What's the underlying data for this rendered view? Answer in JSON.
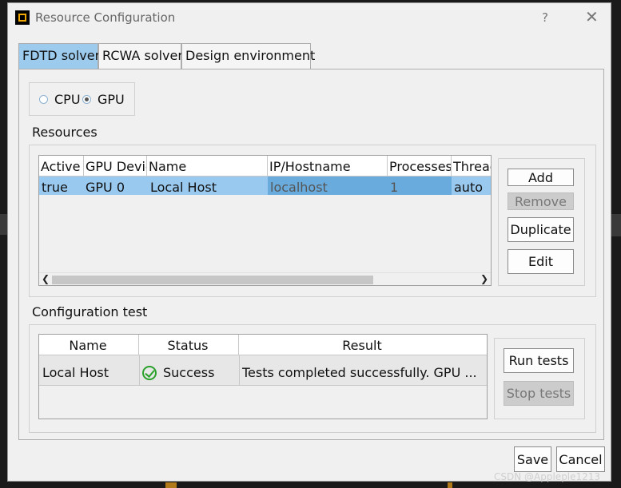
{
  "window": {
    "title": "Resource Configuration",
    "help": "?",
    "close": "✕"
  },
  "tabs": [
    "FDTD solver",
    "RCWA solver",
    "Design environment"
  ],
  "compute": {
    "options": [
      "CPU",
      "GPU"
    ],
    "selected": "GPU"
  },
  "resources": {
    "label": "Resources",
    "columns": [
      "Active",
      "GPU Device",
      "Name",
      "IP/Hostname",
      "Processes",
      "Threads"
    ],
    "rows": [
      {
        "active": "true",
        "gpu_device": "GPU 0",
        "name": "Local Host",
        "host": "localhost",
        "processes": "1",
        "threads": "auto"
      }
    ],
    "buttons": {
      "add": "Add",
      "remove": "Remove",
      "duplicate": "Duplicate",
      "edit": "Edit"
    }
  },
  "config_test": {
    "label": "Configuration test",
    "columns": [
      "Name",
      "Status",
      "Result"
    ],
    "rows": [
      {
        "name": "Local Host",
        "status": "Success",
        "result": "Tests completed successfully. GPU ..."
      }
    ],
    "buttons": {
      "run": "Run tests",
      "stop": "Stop tests"
    }
  },
  "footer": {
    "save": "Save",
    "cancel": "Cancel"
  },
  "watermark": "CSDN @Appleple1213",
  "colors": {
    "tab_active": "#9ccbee",
    "selection": "#99c9ef",
    "success": "#2aa12a"
  }
}
